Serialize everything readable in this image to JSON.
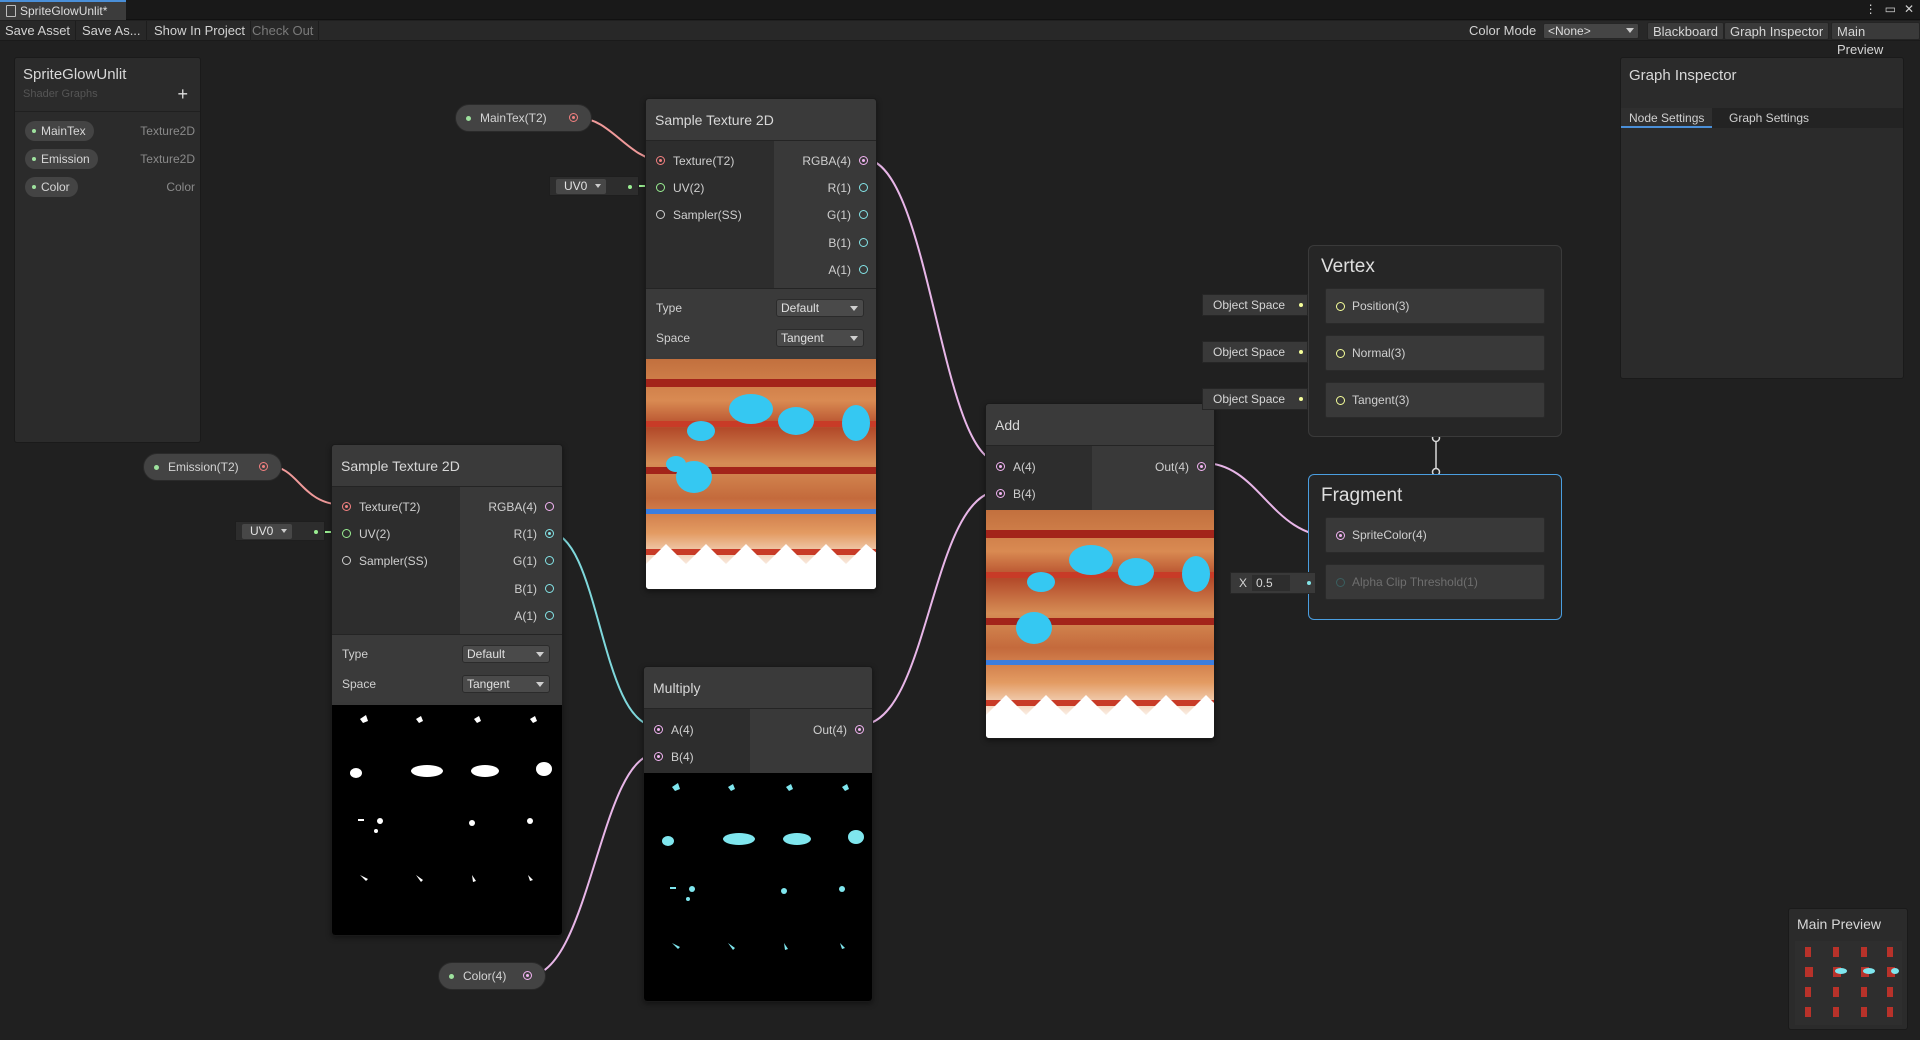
{
  "window": {
    "tab_title": "SpriteGlowUnlit*",
    "controls": [
      "⋮",
      "▭",
      "✕"
    ]
  },
  "toolbar": {
    "save_asset": "Save Asset",
    "save_as": "Save As...",
    "show_in_project": "Show In Project",
    "check_out": "Check Out",
    "color_mode_label": "Color Mode",
    "color_mode_value": "<None>",
    "blackboard": "Blackboard",
    "graph_inspector": "Graph Inspector",
    "main_preview": "Main Preview"
  },
  "blackboard": {
    "title": "SpriteGlowUnlit",
    "subtitle": "Shader Graphs",
    "add_button": "+",
    "properties": [
      {
        "name": "MainTex",
        "type": "Texture2D"
      },
      {
        "name": "Emission",
        "type": "Texture2D"
      },
      {
        "name": "Color",
        "type": "Color"
      }
    ]
  },
  "inspector": {
    "title": "Graph Inspector",
    "tabs": [
      "Node Settings",
      "Graph Settings"
    ],
    "active_tab": "Node Settings"
  },
  "nodes": {
    "sample1": {
      "title": "Sample Texture 2D",
      "inputs": [
        "Texture(T2)",
        "UV(2)",
        "Sampler(SS)"
      ],
      "outputs": [
        "RGBA(4)",
        "R(1)",
        "G(1)",
        "B(1)",
        "A(1)"
      ],
      "type_label": "Type",
      "type_value": "Default",
      "space_label": "Space",
      "space_value": "Tangent"
    },
    "sample2": {
      "title": "Sample Texture 2D",
      "inputs": [
        "Texture(T2)",
        "UV(2)",
        "Sampler(SS)"
      ],
      "outputs": [
        "RGBA(4)",
        "R(1)",
        "G(1)",
        "B(1)",
        "A(1)"
      ],
      "type_label": "Type",
      "type_value": "Default",
      "space_label": "Space",
      "space_value": "Tangent"
    },
    "add": {
      "title": "Add",
      "inputs": [
        "A(4)",
        "B(4)"
      ],
      "output": "Out(4)"
    },
    "multiply": {
      "title": "Multiply",
      "inputs": [
        "A(4)",
        "B(4)"
      ],
      "output": "Out(4)"
    }
  },
  "pills": {
    "maintex": "MainTex(T2)",
    "emission": "Emission(T2)",
    "color": "Color(4)"
  },
  "uv": {
    "value": "UV0"
  },
  "vertex": {
    "title": "Vertex",
    "blocks": [
      "Position(3)",
      "Normal(3)",
      "Tangent(3)"
    ],
    "space_inputs": [
      "Object Space",
      "Object Space",
      "Object Space"
    ]
  },
  "fragment": {
    "title": "Fragment",
    "blocks": [
      "SpriteColor(4)",
      "Alpha Clip Threshold(1)"
    ],
    "alpha_x_label": "X",
    "alpha_value": "0.5"
  },
  "main_preview": {
    "title": "Main Preview"
  },
  "colors": {
    "accent": "#4a8fd8",
    "texture_port": "#f28080",
    "vector4_port": "#f2b3f2",
    "float_port": "#84e4e7",
    "vector3_port": "#f6ff9a",
    "vector2_port": "#9aef92",
    "wire_pink": "#e8b6e8",
    "wire_cyan": "#7fd8dc"
  }
}
